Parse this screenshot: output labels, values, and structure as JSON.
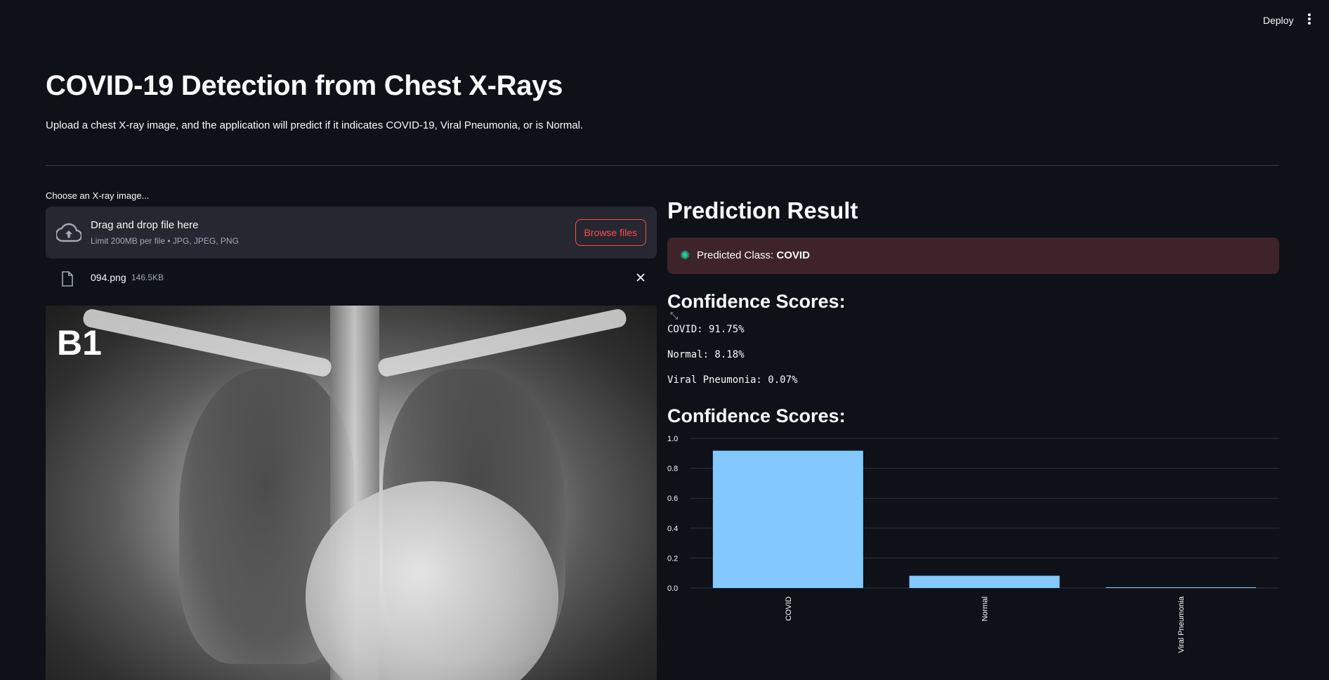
{
  "toolbar": {
    "deploy_label": "Deploy"
  },
  "header": {
    "title": "COVID-19 Detection from Chest X-Rays",
    "subtitle": "Upload a chest X-ray image, and the application will predict if it indicates COVID-19, Viral Pneumonia, or is Normal."
  },
  "uploader": {
    "label": "Choose an X-ray image...",
    "drop_text": "Drag and drop file here",
    "limit_text": "Limit 200MB per file • JPG, JPEG, PNG",
    "browse_label": "Browse files",
    "file": {
      "name": "094.png",
      "size": "146.5KB"
    }
  },
  "image": {
    "overlay_text": "B1"
  },
  "result": {
    "title": "Prediction Result",
    "predicted_prefix": "Predicted Class: ",
    "predicted_class": "COVID",
    "scores_title": "Confidence Scores:",
    "scores": [
      {
        "text": "COVID: 91.75%"
      },
      {
        "text": "Normal: 8.18%"
      },
      {
        "text": "Viral Pneumonia: 0.07%"
      }
    ],
    "chart_title": "Confidence Scores:"
  },
  "colors": {
    "background": "#0e1117",
    "accent": "#ff4b4b",
    "bar": "#83c9ff",
    "error_box": "#3e2428"
  },
  "chart_data": {
    "type": "bar",
    "categories": [
      "COVID",
      "Normal",
      "Viral Pneumonia"
    ],
    "values": [
      0.9175,
      0.0818,
      0.0007
    ],
    "title": "",
    "xlabel": "",
    "ylabel": "",
    "ylim": [
      0,
      1.0
    ],
    "yticks": [
      "0.0",
      "0.2",
      "0.4",
      "0.6",
      "0.8",
      "1.0"
    ],
    "grid": true
  }
}
